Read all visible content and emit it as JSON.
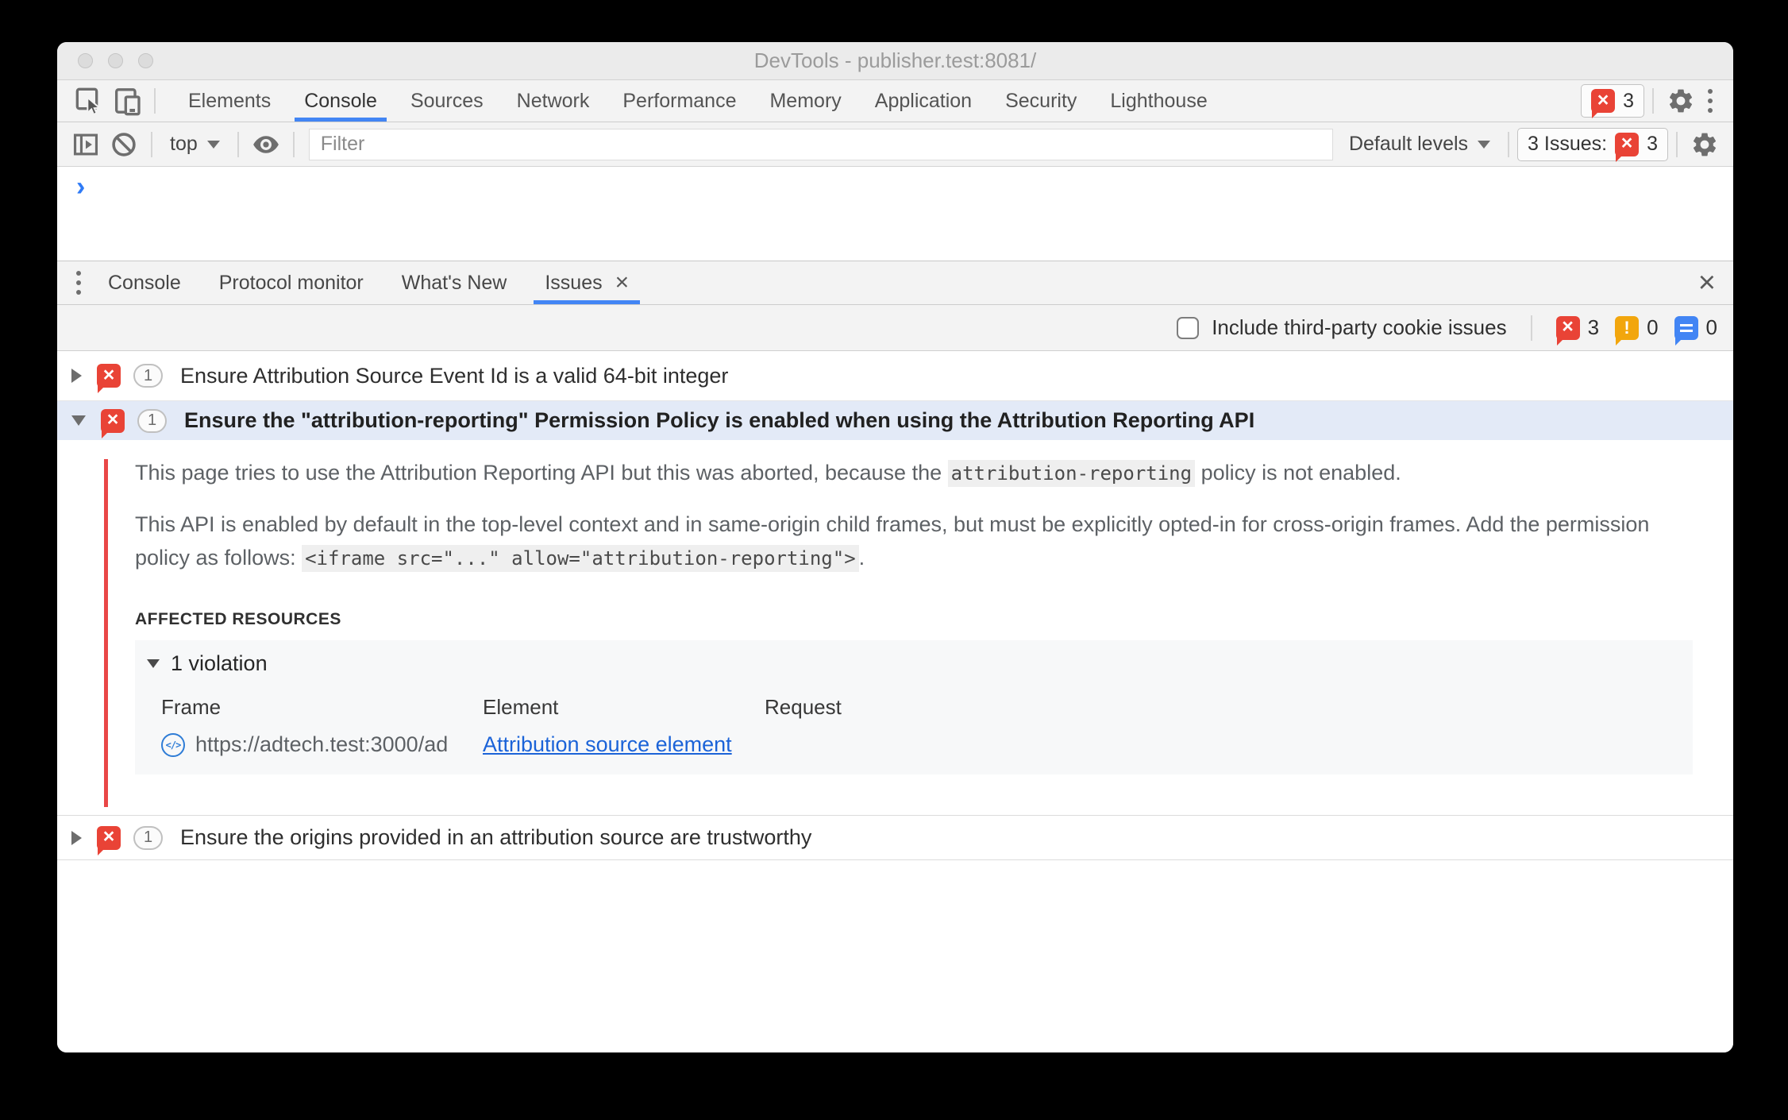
{
  "colors": {
    "accent_blue": "#4285f4",
    "error_red": "#e94336",
    "warning_orange": "#f2a60d",
    "info_blue": "#4285f4",
    "selected_row_blue": "#e3eaf7",
    "issue_marker_red": "#e94747",
    "link_blue": "#1b63d8"
  },
  "window": {
    "title": "DevTools - publisher.test:8081/"
  },
  "main_toolbar": {
    "tabs": [
      "Elements",
      "Console",
      "Sources",
      "Network",
      "Performance",
      "Memory",
      "Application",
      "Security",
      "Lighthouse"
    ],
    "active_tab": "Console",
    "error_count": "3"
  },
  "console_toolbar": {
    "context": "top",
    "filter_placeholder": "Filter",
    "levels": "Default levels",
    "issues_label": "3 Issues:",
    "issues_count": "3"
  },
  "console": {
    "prompt": "›"
  },
  "drawer": {
    "tabs": [
      "Console",
      "Protocol monitor",
      "What's New",
      "Issues"
    ],
    "active_tab": "Issues",
    "tab_close_glyph": "×",
    "close_glyph": "×"
  },
  "issues_toolbar": {
    "checkbox_label": "Include third-party cookie issues",
    "error_count": "3",
    "warning_count": "0",
    "info_count": "0"
  },
  "issues": {
    "row1": {
      "count": "1",
      "title": "Ensure Attribution Source Event Id is a valid 64-bit integer"
    },
    "row2": {
      "count": "1",
      "title": "Ensure the \"attribution-reporting\" Permission Policy is enabled when using the Attribution Reporting API",
      "p1_before": "This page tries to use the Attribution Reporting API but this was aborted, because the ",
      "p1_code": "attribution-reporting",
      "p1_after": " policy is not enabled.",
      "p2_before": "This API is enabled by default in the top-level context and in same-origin child frames, but must be explicitly opted-in for cross-origin frames. Add the permission policy as follows: ",
      "p2_code": "<iframe src=\"...\" allow=\"attribution-reporting\">",
      "p2_after": ".",
      "affected_heading": "AFFECTED RESOURCES",
      "violation_label": "1 violation",
      "col_frame": "Frame",
      "col_element": "Element",
      "col_request": "Request",
      "frame_icon_glyph": "</>",
      "frame_url": "https://adtech.test:3000/ad",
      "element_link": "Attribution source element",
      "request_value": ""
    },
    "row3": {
      "count": "1",
      "title": "Ensure the origins provided in an attribution source are trustworthy"
    }
  }
}
